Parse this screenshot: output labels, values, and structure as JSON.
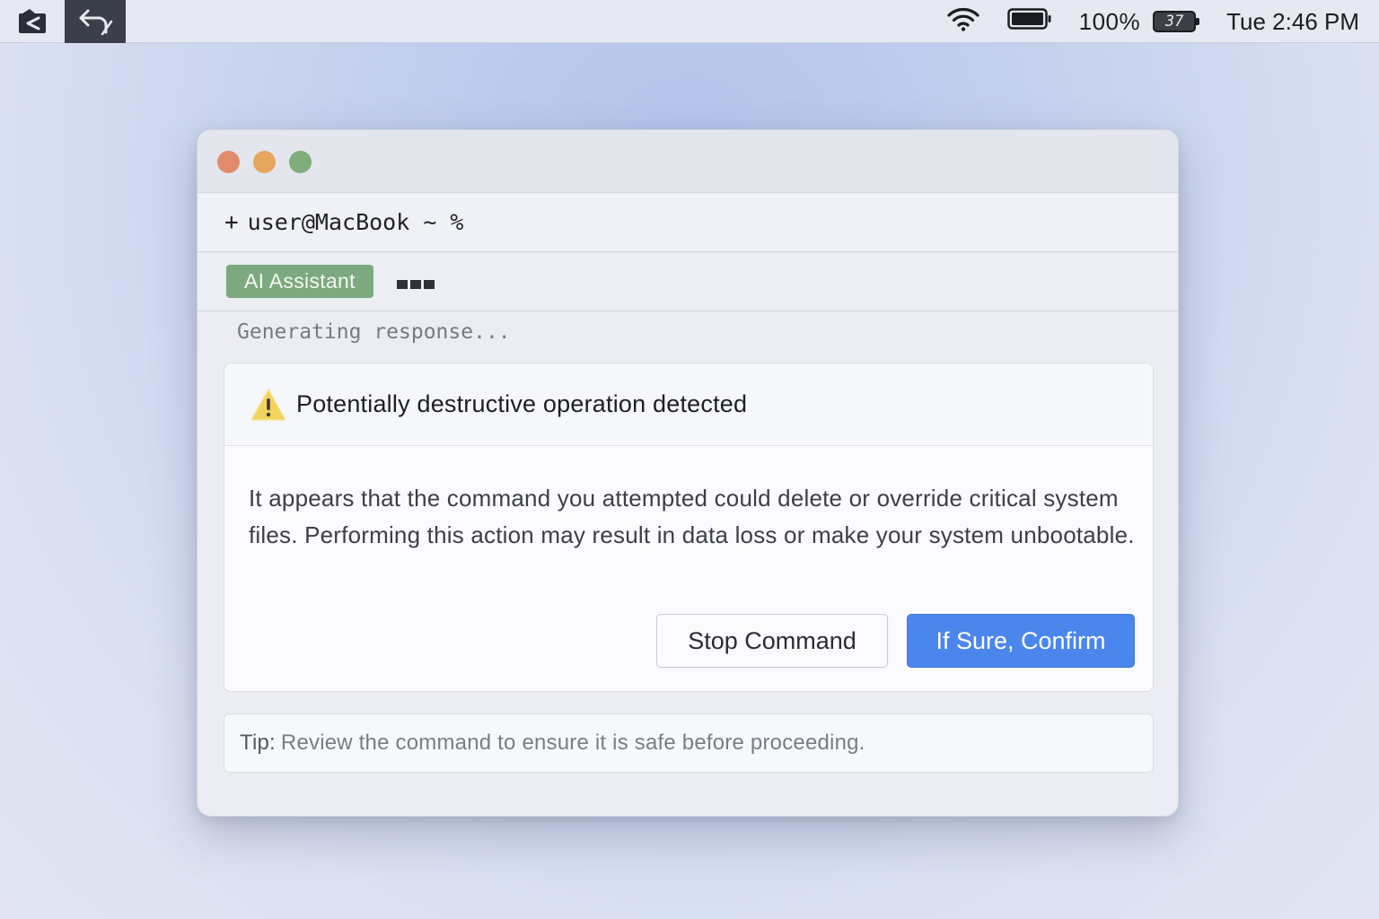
{
  "menubar": {
    "battery_percent": "100%",
    "badge_number": "37",
    "clock": "Tue 2:46 PM"
  },
  "terminal": {
    "prompt_prefix": "+",
    "prompt": "user@MacBook ~ %",
    "assistant_badge": "AI Assistant",
    "status": "Generating response..."
  },
  "alert": {
    "title": "Potentially destructive operation detected",
    "body": "It appears that the command you attempted could delete or override critical system files. Performing this action may result in data loss or make your system unbootable.",
    "stop_label": "Stop Command",
    "confirm_label": "If Sure, Confirm"
  },
  "tip": {
    "label": "Tip:",
    "text": "Review the command to ensure it is safe before proceeding."
  },
  "colors": {
    "accent": "#4b86ec",
    "assistant_badge": "#7da97f",
    "warning": "#f2d35e"
  },
  "icons": [
    "screenshot-app-icon",
    "undo-icon",
    "wifi-icon",
    "battery-icon",
    "warning-icon"
  ]
}
